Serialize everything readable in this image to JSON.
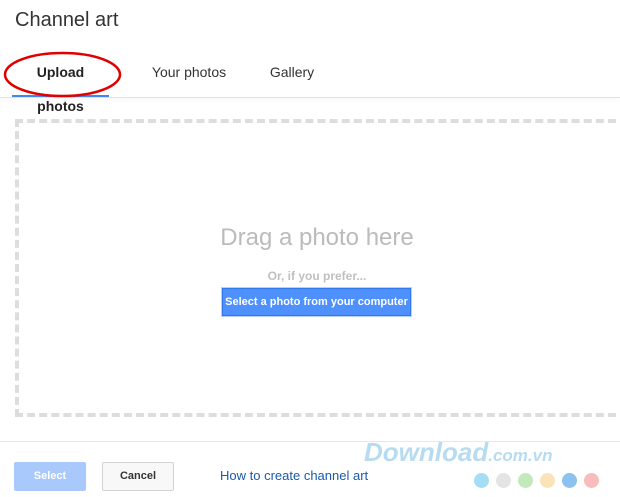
{
  "dialog": {
    "title": "Channel art"
  },
  "tabs": [
    {
      "label": "Upload photos",
      "active": true
    },
    {
      "label": "Your photos",
      "active": false
    },
    {
      "label": "Gallery",
      "active": false
    }
  ],
  "drop_zone": {
    "title": "Drag a photo here",
    "subtitle": "Or, if you prefer...",
    "select_button_label": "Select a photo from your computer"
  },
  "footer": {
    "select_label": "Select",
    "cancel_label": "Cancel",
    "help_link_label": "How to create channel art"
  },
  "watermark": {
    "brand": "Download",
    "domain": ".com.vn",
    "dot_colors": [
      "#7fd0f0",
      "#d8d8d8",
      "#a8e0a0",
      "#f8d898",
      "#5aa8e8",
      "#f6a0a0"
    ]
  },
  "colors": {
    "accent": "#4285f4",
    "primary_button": "#4d90fe",
    "disabled_button": "#a9c8fb",
    "link": "#1a5aab",
    "highlight_annotation": "#e00000"
  }
}
